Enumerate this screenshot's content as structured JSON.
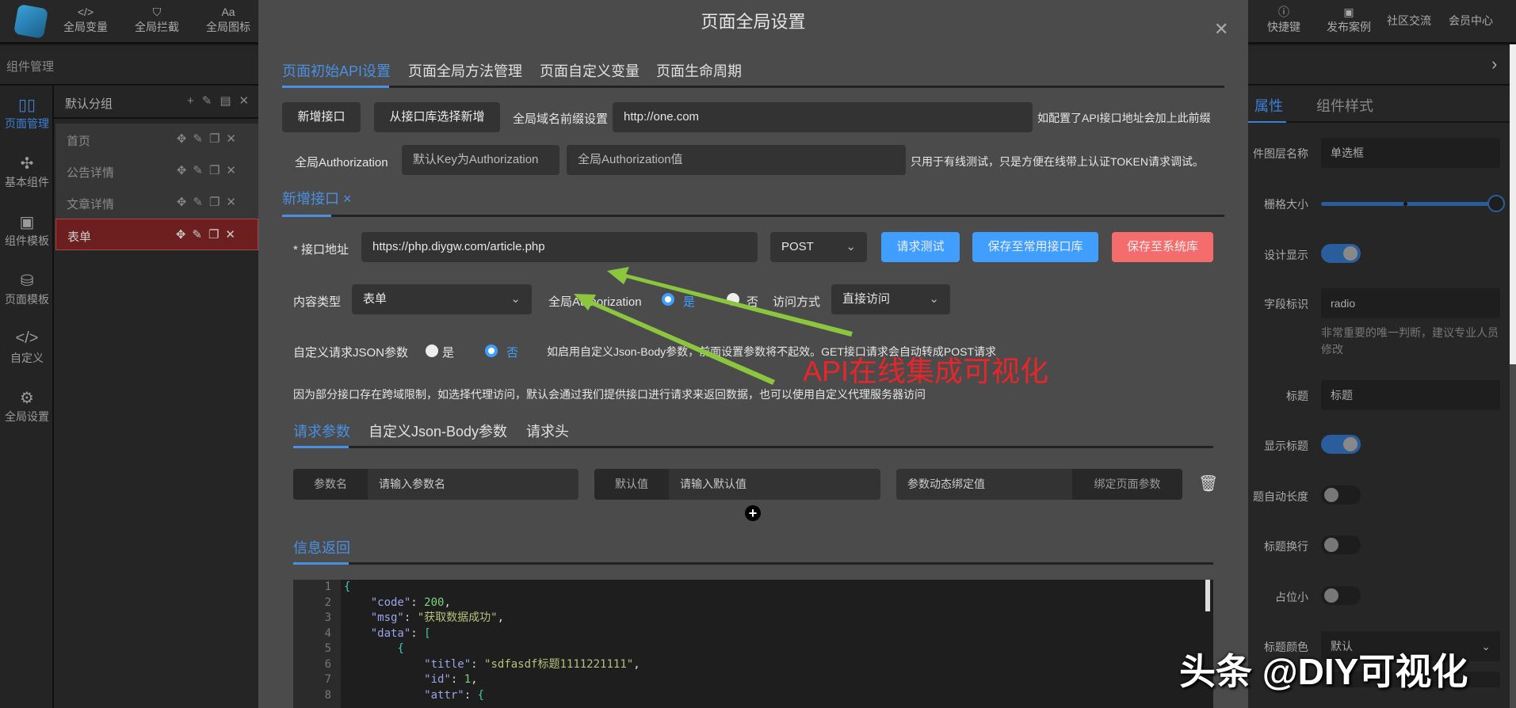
{
  "topbar": {
    "left_items": [
      {
        "icon": "code-icon",
        "label": "全局变量"
      },
      {
        "icon": "shield-icon",
        "label": "全局拦截"
      },
      {
        "icon": "font-icon",
        "label": "全局图标"
      }
    ],
    "right_items": [
      {
        "icon": "help-icon",
        "label": "快捷键"
      },
      {
        "icon": "template-icon",
        "label": "发布案例"
      },
      {
        "label": "社区交流"
      },
      {
        "label": "会员中心"
      }
    ]
  },
  "subbar": {
    "title": "组件管理"
  },
  "sidenav": [
    {
      "icon": "layout-icon",
      "label": "页面管理",
      "active": true
    },
    {
      "icon": "puzzle-icon",
      "label": "基本组件"
    },
    {
      "icon": "template-icon",
      "label": "组件模板"
    },
    {
      "icon": "database-icon",
      "label": "页面模板"
    },
    {
      "icon": "code-icon",
      "label": "自定义"
    },
    {
      "icon": "gear-icon",
      "label": "全局设置"
    }
  ],
  "pages": {
    "group": "默认分组",
    "items": [
      "首页",
      "公告详情",
      "文章详情",
      "表单"
    ],
    "selected": "表单"
  },
  "modal": {
    "title": "页面全局设置",
    "tabs": [
      "页面初始API设置",
      "页面全局方法管理",
      "页面自定义变量",
      "页面生命周期"
    ],
    "add_api": "新增接口",
    "from_lib": "从接口库选择新增",
    "domain_label": "全局域名前缀设置",
    "domain_value": "http://one.com",
    "domain_hint": "如配置了API接口地址会加上此前缀",
    "auth_label": "全局Authorization",
    "auth_key_placeholder": "默认Key为Authorization",
    "auth_value_placeholder": "全局Authorization值",
    "auth_hint": "只用于有线测试，只是方便在线带上认证TOKEN请求调试。",
    "sub_tab": "新增接口",
    "sub_tab_close": "×",
    "url_label": "* 接口地址",
    "url_value": "https://php.diygw.com/article.php",
    "method": "POST",
    "btn_test": "请求测试",
    "btn_save_common": "保存至常用接口库",
    "btn_save_system": "保存至系统库",
    "content_type_label": "内容类型",
    "content_type": "表单",
    "global_auth_label": "全局Authorization",
    "yes": "是",
    "no": "否",
    "global_auth": "是",
    "access_label": "访问方式",
    "access_value": "直接访问",
    "json_label": "自定义请求JSON参数",
    "json_value": "否",
    "json_hint": "如启用自定义Json-Body参数，前面设置参数将不起效。GET接口请求会自动转成POST请求",
    "proxy_hint": "因为部分接口存在跨域限制，如选择代理访问，默认会通过我们提供接口进行请求来返回数据，也可以使用自定义代理服务器访问",
    "param_tabs": [
      "请求参数",
      "自定义Json-Body参数",
      "请求头"
    ],
    "param": {
      "name_label": "参数名",
      "name_placeholder": "请输入参数名",
      "default_label": "默认值",
      "default_placeholder": "请输入默认值",
      "bind_placeholder": "参数动态绑定值",
      "bind_button": "绑定页面参数"
    },
    "response_tab": "信息返回",
    "code_lines": [
      {
        "n": "1",
        "t": "{"
      },
      {
        "n": "2",
        "k": "\"code\"",
        "v": "200",
        "vt": "n"
      },
      {
        "n": "3",
        "k": "\"msg\"",
        "v": "\"获取数据成功\"",
        "vt": "s"
      },
      {
        "n": "4",
        "k": "\"data\"",
        "v": "[",
        "vt": "b"
      },
      {
        "n": "5",
        "t": "{"
      },
      {
        "n": "6",
        "k": "\"title\"",
        "v": "\"sdfasdf标题1111221111\"",
        "vt": "s"
      },
      {
        "n": "7",
        "k": "\"id\"",
        "v": "1",
        "vt": "n"
      },
      {
        "n": "8",
        "k": "\"attr\"",
        "v": "{",
        "vt": "b"
      }
    ]
  },
  "rpanel": {
    "tabs": [
      "属性",
      "组件样式"
    ],
    "layer_name_label": "件图层名称",
    "layer_name": "单选框",
    "grid_label": "栅格大小",
    "grid_value": 1.0,
    "design_show_label": "设计显示",
    "field_label": "字段标识",
    "field_value": "radio",
    "field_hint": "非常重要的唯一判断，建议专业人员修改",
    "title_label": "标题",
    "title_value": "标题",
    "show_title_label": "显示标题",
    "auto_len_label": "题自动长度",
    "wrap_label": "标题换行",
    "small_label": "占位小",
    "color_label": "标题颜色",
    "color_value": "默认"
  },
  "annotation": "API在线集成可视化",
  "watermark": "头条 @DIY可视化",
  "colors": {
    "accent": "#409eff",
    "danger": "#f56c6c",
    "selected_page": "#6d1f1f",
    "annotation": "#e8262a",
    "arrow": "#8cc63f"
  }
}
